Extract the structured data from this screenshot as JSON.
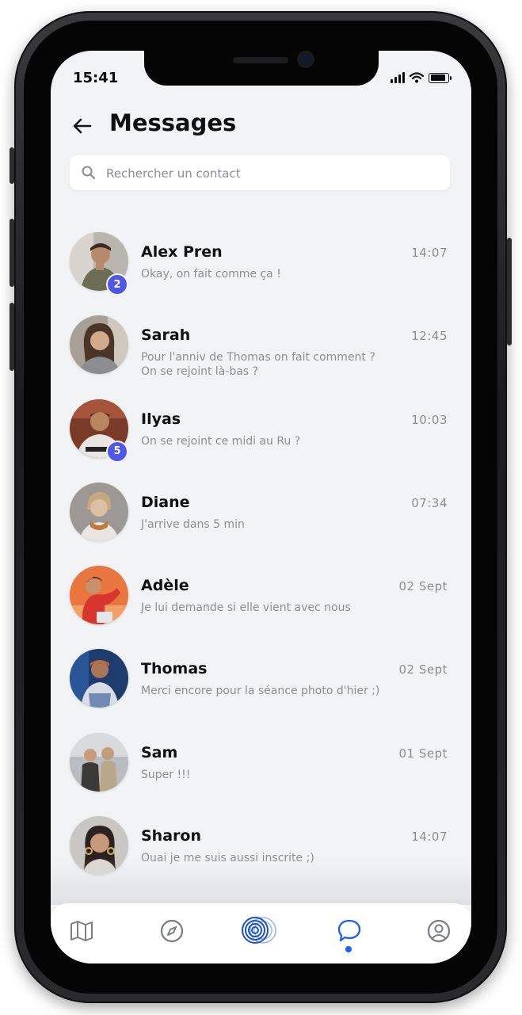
{
  "status_bar": {
    "time": "15:41"
  },
  "header": {
    "title": "Messages"
  },
  "search": {
    "placeholder": "Rechercher un contact"
  },
  "conversations": [
    {
      "name": "Alex Pren",
      "preview": "Okay, on fait comme ça !",
      "time": "14:07",
      "unread": "2"
    },
    {
      "name": "Sarah",
      "preview": "Pour l'anniv de Thomas on fait comment ?\nOn se rejoint là-bas ?",
      "time": "12:45"
    },
    {
      "name": "Ilyas",
      "preview": "On se rejoint ce midi au Ru ?",
      "time": "10:03",
      "unread": "5"
    },
    {
      "name": "Diane",
      "preview": "J'arrive dans  5 min",
      "time": "07:34"
    },
    {
      "name": "Adèle",
      "preview": "Je lui demande si elle vient avec nous",
      "time": "02 Sept"
    },
    {
      "name": "Thomas",
      "preview": "Merci encore pour la séance photo d'hier ;)",
      "time": "02 Sept"
    },
    {
      "name": "Sam",
      "preview": "Super !!!",
      "time": "01 Sept"
    },
    {
      "name": "Sharon",
      "preview": "Ouai je me suis aussi inscrite ;)",
      "time": "14:07"
    }
  ],
  "tab_bar": {
    "items": [
      "map-icon",
      "compass-icon",
      "radar-icon",
      "chat-icon",
      "profile-icon"
    ],
    "active": "chat-icon"
  },
  "colors": {
    "accent": "#1a5fff",
    "badge": "#5057e6",
    "background": "#f2f3f5",
    "muted_text": "#8b8e94"
  }
}
